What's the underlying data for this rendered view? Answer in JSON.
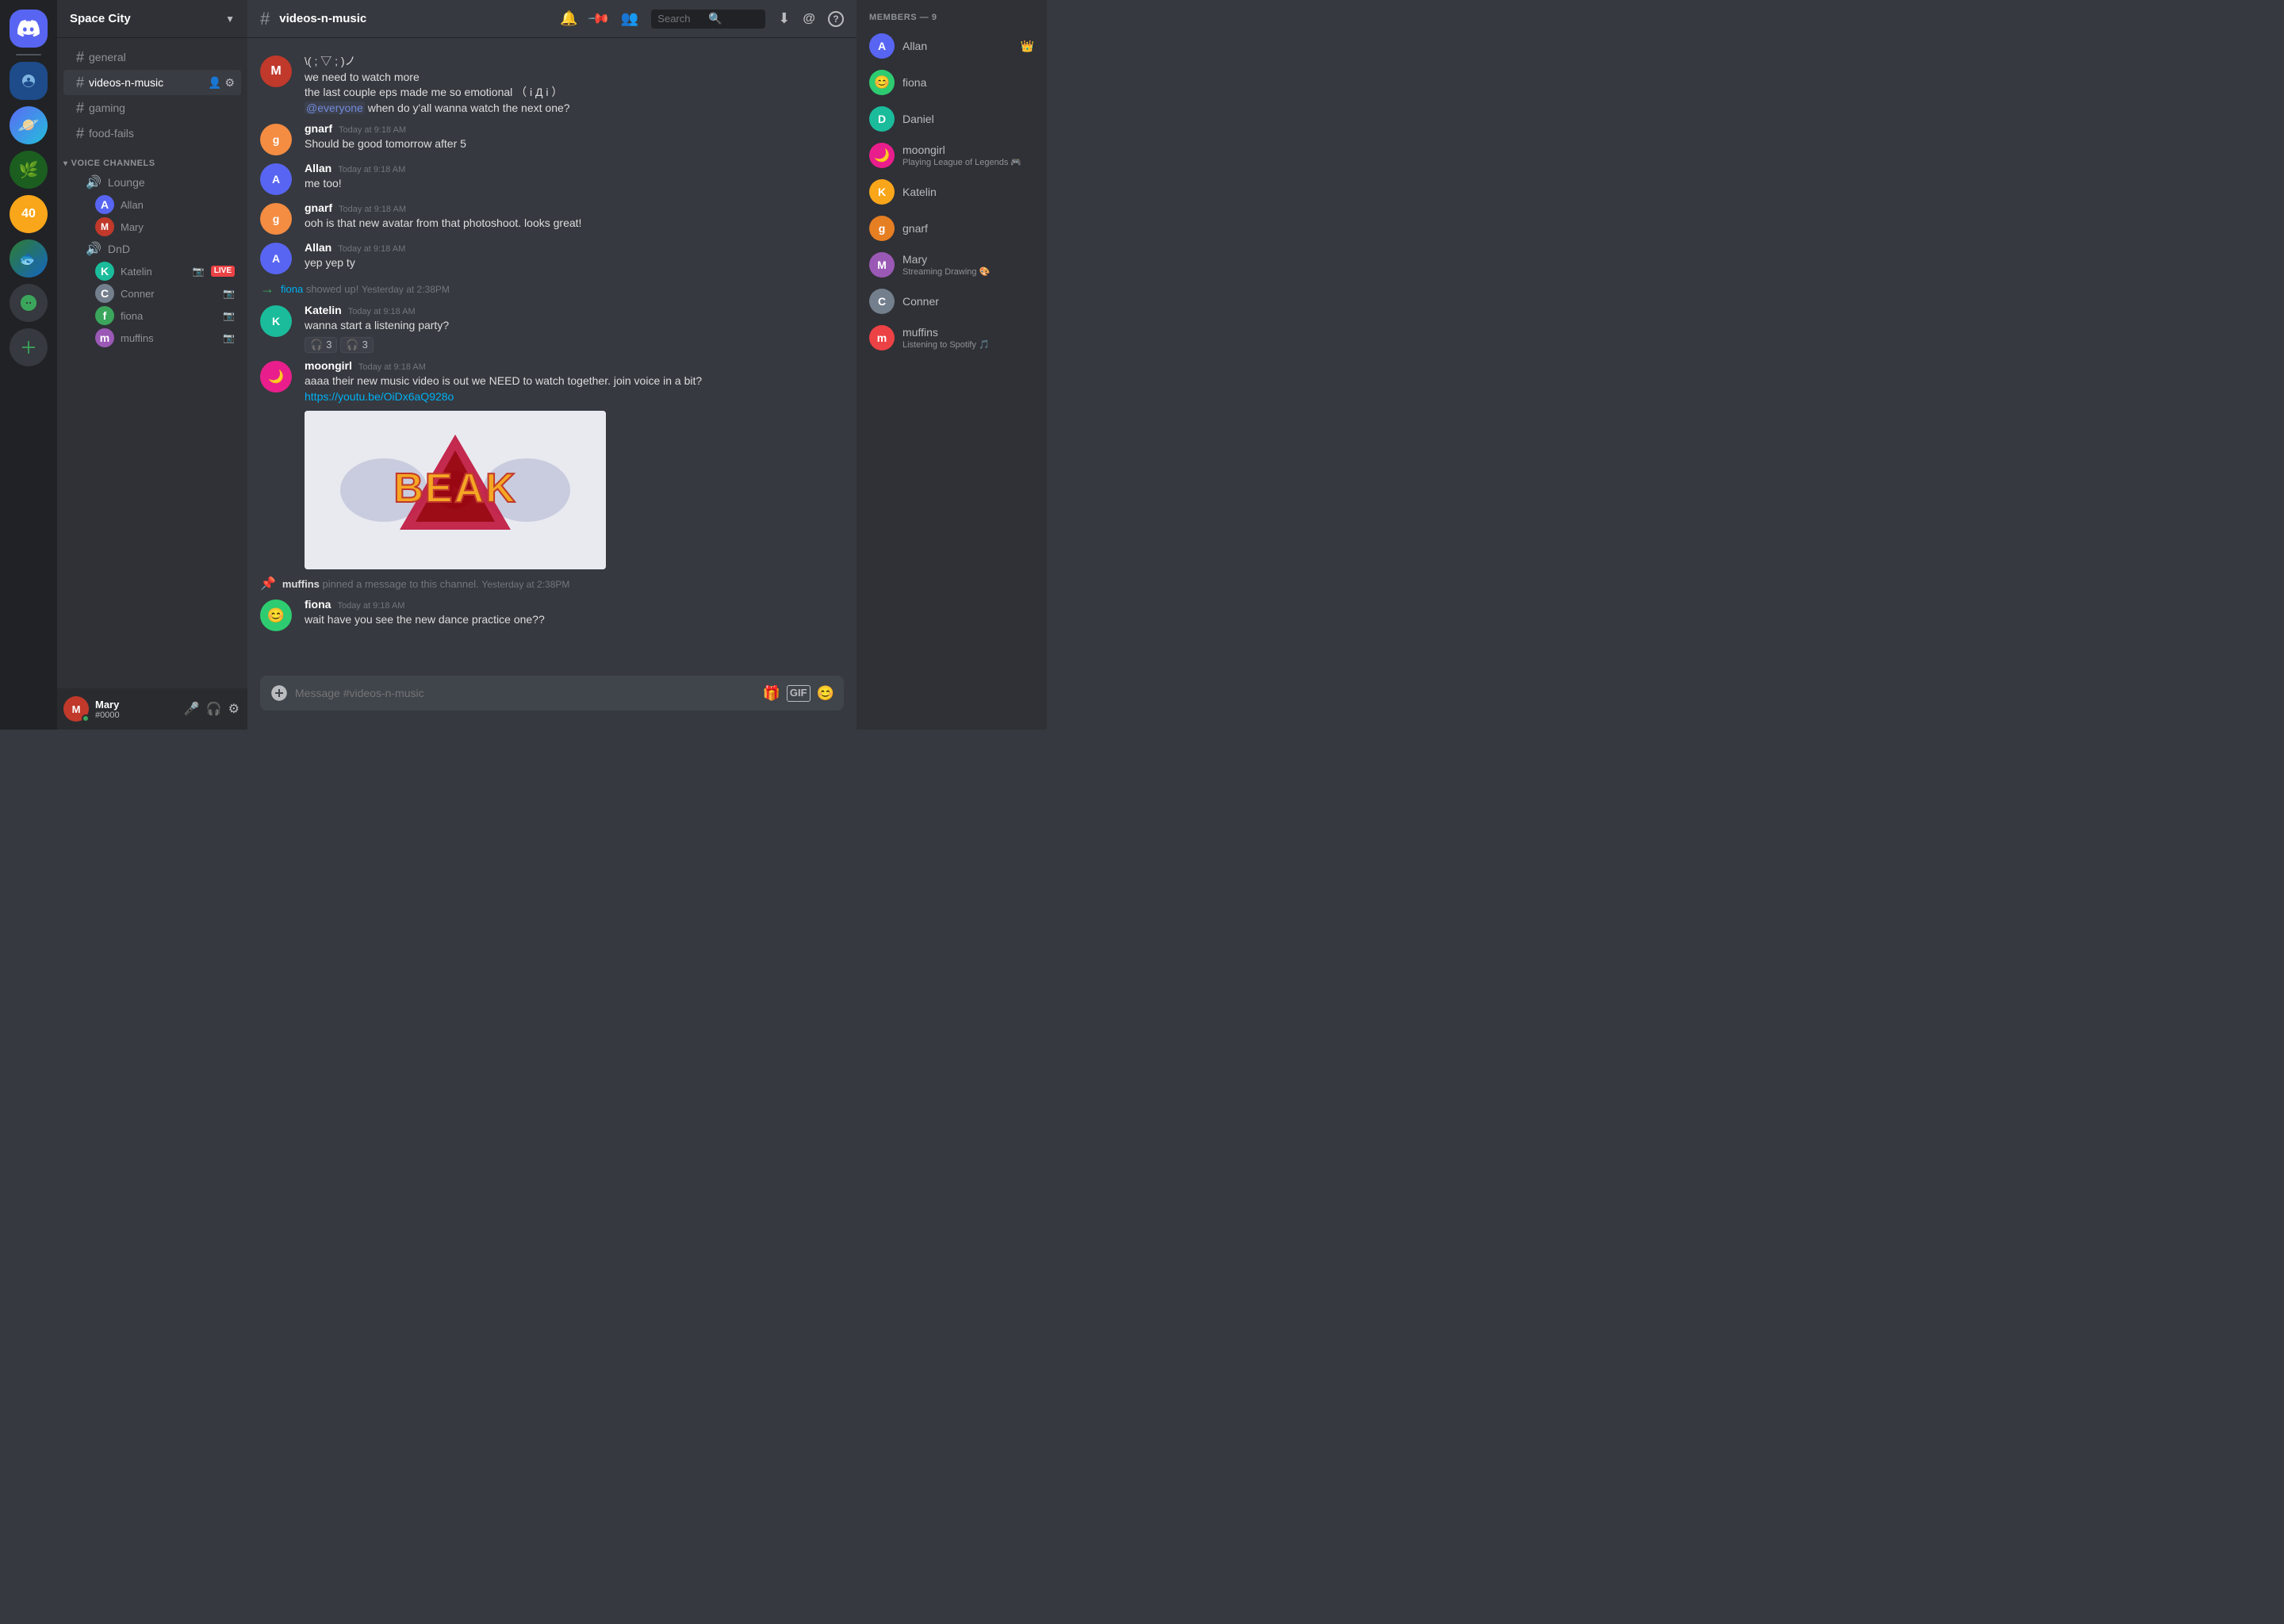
{
  "app": {
    "title": "DISCORD"
  },
  "server": {
    "name": "Space City",
    "dropdown_label": "Space City"
  },
  "channel": {
    "name": "videos-n-music",
    "placeholder": "Message #videos-n-music"
  },
  "sidebar": {
    "channels": [
      {
        "type": "text",
        "name": "general",
        "active": false
      },
      {
        "type": "text",
        "name": "videos-n-music",
        "active": true
      },
      {
        "type": "text",
        "name": "gaming",
        "active": false
      },
      {
        "type": "text",
        "name": "food-fails",
        "active": false
      }
    ],
    "voice_section": "VOICE CHANNELS",
    "voice_channels": [
      {
        "name": "Lounge",
        "members": [
          {
            "name": "Allan",
            "color": "av-blue"
          },
          {
            "name": "Mary",
            "color": "av-pink"
          }
        ]
      },
      {
        "name": "DnD",
        "members": [
          {
            "name": "Katelin",
            "color": "av-teal",
            "live": true
          },
          {
            "name": "Conner",
            "color": "av-gray"
          },
          {
            "name": "fiona",
            "color": "av-green"
          },
          {
            "name": "muffins",
            "color": "av-purple"
          }
        ]
      }
    ]
  },
  "user_panel": {
    "name": "Mary",
    "tag": "#0000",
    "status": "online"
  },
  "header": {
    "search_placeholder": "Search"
  },
  "messages": [
    {
      "id": "msg1",
      "type": "continuation",
      "avatar_color": "av-pink",
      "author": "",
      "time": "",
      "lines": [
        "\\( ; ▽ ; )ノ",
        "we need to watch more",
        "the last couple eps made me so emotional （ i Д i ）",
        "@everyone when do y'all wanna watch the next one?"
      ],
      "mention_everyone": true
    },
    {
      "id": "msg2",
      "type": "full",
      "avatar_color": "av-orange",
      "author": "gnarf",
      "time": "Today at 9:18 AM",
      "text": "Should be good tomorrow after 5"
    },
    {
      "id": "msg3",
      "type": "full",
      "avatar_color": "av-blue",
      "author": "Allan",
      "time": "Today at 9:18 AM",
      "text": "me too!"
    },
    {
      "id": "msg4",
      "type": "full",
      "avatar_color": "av-orange",
      "author": "gnarf",
      "time": "Today at 9:18 AM",
      "text": "ooh is that new avatar from that photoshoot. looks great!"
    },
    {
      "id": "msg5",
      "type": "full",
      "avatar_color": "av-blue",
      "author": "Allan",
      "time": "Today at 9:18 AM",
      "text": "yep yep ty"
    },
    {
      "id": "msg6",
      "type": "system_join",
      "actor": "fiona",
      "action": "showed up!",
      "time": "Yesterday at 2:38PM"
    },
    {
      "id": "msg7",
      "type": "full",
      "avatar_color": "av-teal",
      "author": "Katelin",
      "time": "Today at 9:18 AM",
      "text": "wanna start a listening party?",
      "reactions": [
        {
          "emoji": "🎧",
          "count": "3"
        },
        {
          "emoji": "🎧",
          "count": "3"
        }
      ]
    },
    {
      "id": "msg8",
      "type": "full",
      "avatar_color": "av-pink",
      "author": "moongirl",
      "time": "Today at 9:18 AM",
      "text": "aaaa their new music video is out we NEED to watch together. join voice in a bit?",
      "link": "https://youtu.be/OiDx6aQ928o",
      "has_video": true
    },
    {
      "id": "msg9",
      "type": "system_pin",
      "actor": "muffins",
      "action": "pinned a message to this channel.",
      "time": "Yesterday at 2:38PM"
    },
    {
      "id": "msg10",
      "type": "full",
      "avatar_color": "av-green",
      "author": "fiona",
      "time": "Today at 9:18 AM",
      "text": "wait have you see the new dance practice one??"
    }
  ],
  "members": {
    "header": "MEMBERS — 9",
    "list": [
      {
        "name": "Allan",
        "color": "av-blue",
        "badge": "👑"
      },
      {
        "name": "fiona",
        "color": "av-green"
      },
      {
        "name": "Daniel",
        "color": "av-teal"
      },
      {
        "name": "moongirl",
        "color": "av-pink",
        "status": "Playing League of Legends"
      },
      {
        "name": "Katelin",
        "color": "av-yellow"
      },
      {
        "name": "gnarf",
        "color": "av-orange"
      },
      {
        "name": "Mary",
        "color": "av-purple",
        "status": "Streaming Drawing 🎨"
      },
      {
        "name": "Conner",
        "color": "av-gray"
      },
      {
        "name": "muffins",
        "color": "av-red",
        "status": "Listening to Spotify 🎵"
      }
    ]
  },
  "icons": {
    "discord": "🎮",
    "bell": "🔔",
    "pin": "📌",
    "members": "👥",
    "search": "🔍",
    "download": "⬇",
    "at": "@",
    "question": "?",
    "hash": "#",
    "speaker": "🔊",
    "mic": "🎤",
    "headphones": "🎧",
    "settings": "⚙",
    "gift": "🎁",
    "gif": "GIF",
    "emoji": "😊",
    "add": "+",
    "chevron": "▾",
    "expand": "▸",
    "camera": "📷",
    "pin_sys": "📌",
    "arrow_right": "→",
    "user_add": "👤",
    "cog": "⚙"
  }
}
